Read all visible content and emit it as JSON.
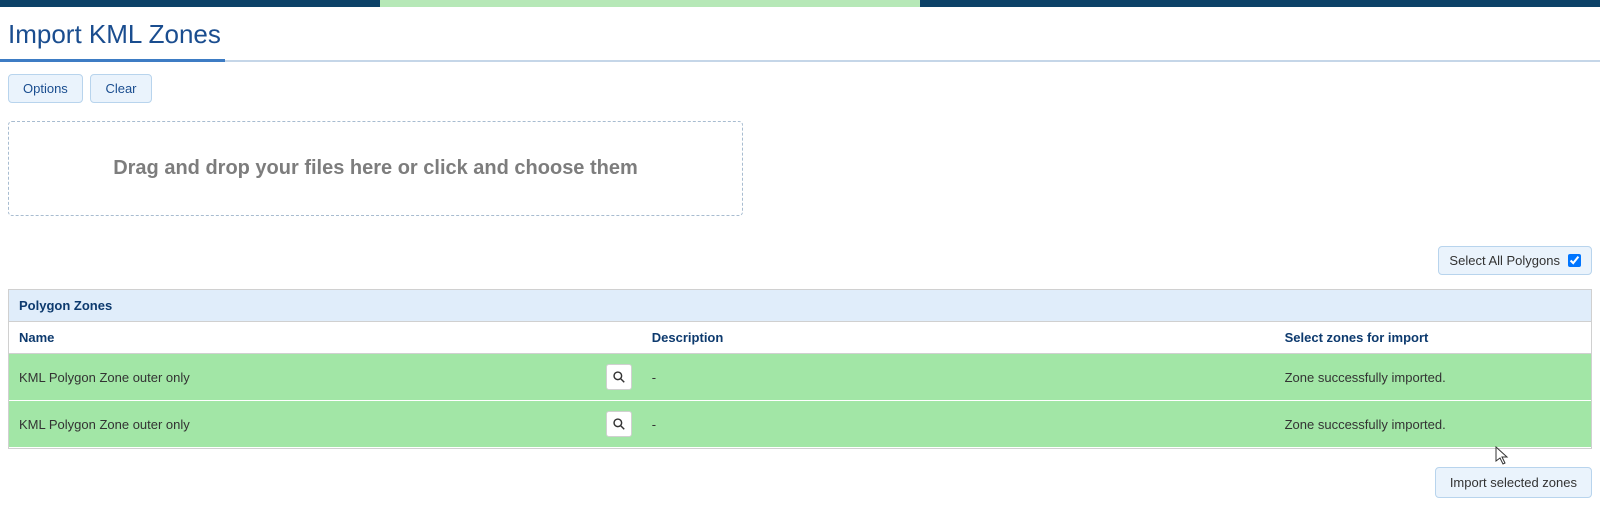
{
  "page": {
    "title": "Import KML Zones"
  },
  "toolbar": {
    "options_label": "Options",
    "clear_label": "Clear"
  },
  "dropzone": {
    "text": "Drag and drop your files here or click and choose them"
  },
  "select_all": {
    "label": "Select All Polygons",
    "checked": true
  },
  "table": {
    "section_header": "Polygon Zones",
    "headers": {
      "name": "Name",
      "description": "Description",
      "select": "Select zones for import"
    },
    "rows": [
      {
        "name": "KML Polygon Zone outer only",
        "description": "-",
        "status": "Zone successfully imported."
      },
      {
        "name": "KML Polygon Zone outer only",
        "description": "-",
        "status": "Zone successfully imported."
      }
    ]
  },
  "footer": {
    "import_label": "Import selected zones"
  }
}
